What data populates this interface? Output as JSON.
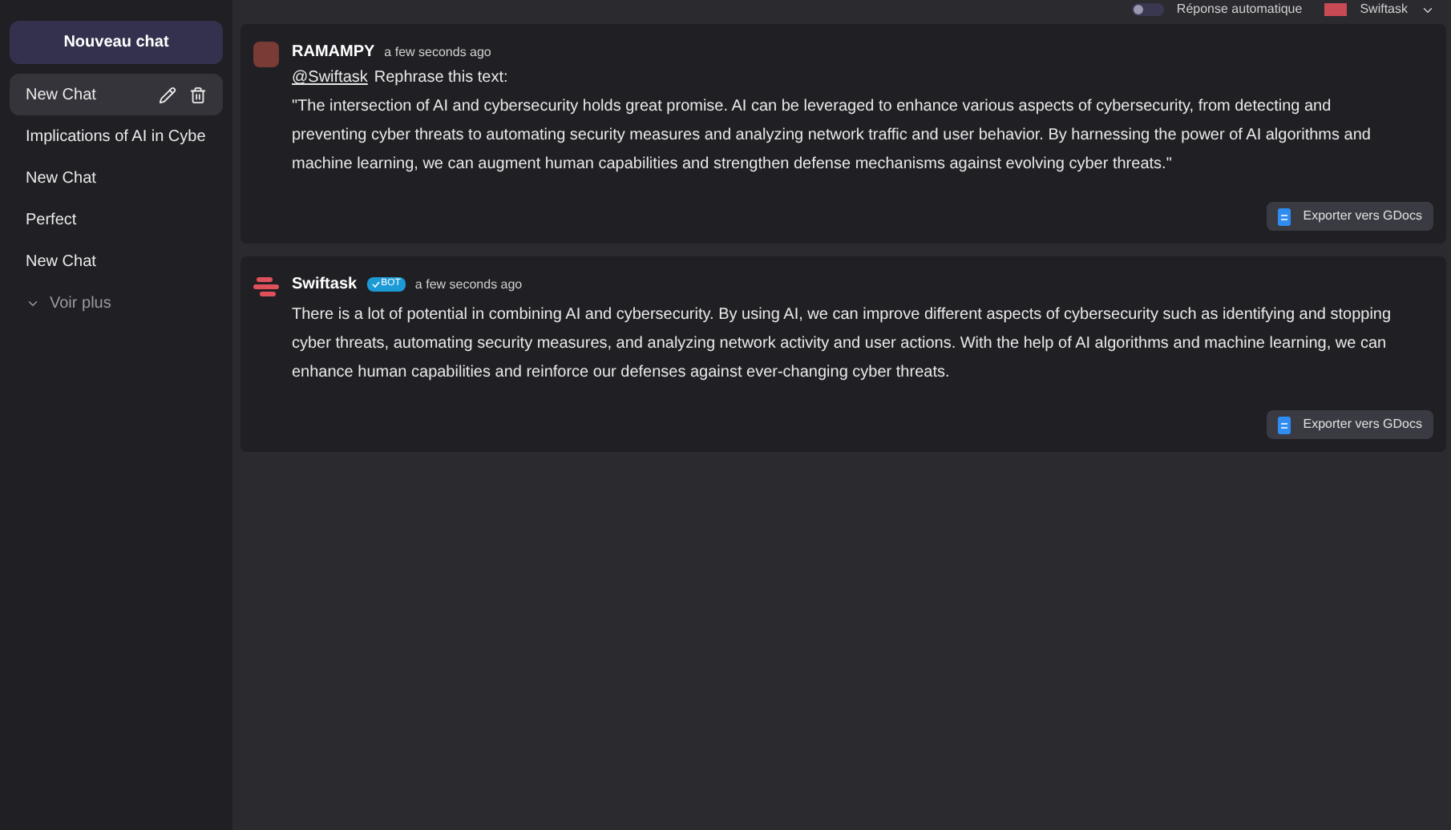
{
  "sidebar": {
    "new_chat_button": "Nouveau chat",
    "items": [
      {
        "label": "New Chat",
        "selected": true
      },
      {
        "label": "Implications of AI in Cybe",
        "selected": false
      },
      {
        "label": "New Chat",
        "selected": false
      },
      {
        "label": "Perfect",
        "selected": false
      },
      {
        "label": "New Chat",
        "selected": false
      }
    ],
    "more": "Voir plus"
  },
  "header": {
    "auto_reply_on": false,
    "auto_reply": "Réponse automatique",
    "assistant": "Swiftask"
  },
  "messages": [
    {
      "kind": "user",
      "author": "RAMAMPY",
      "time": "a few seconds ago",
      "mention": "@Swiftask",
      "lead": "Rephrase this text:",
      "text": "\"The intersection of AI and cybersecurity holds great promise. AI can be leveraged to enhance various aspects of cybersecurity, from detecting and preventing cyber threats to automating security measures and analyzing network traffic and user behavior. By harnessing the power of AI algorithms and machine learning, we can augment human capabilities and strengthen defense mechanisms against evolving cyber threats.\"",
      "export": "Exporter vers GDocs"
    },
    {
      "kind": "bot",
      "author": "Swiftask",
      "badge": "BOT",
      "time": "a few seconds ago",
      "text": "There is a lot of potential in combining AI and cybersecurity. By using AI, we can improve different aspects of cybersecurity such as identifying and stopping cyber threats, automating security measures, and analyzing network activity and user actions. With the help of AI algorithms and machine learning, we can enhance human capabilities and reinforce our defenses against ever-changing cyber threats.",
      "export": "Exporter vers GDocs"
    }
  ]
}
